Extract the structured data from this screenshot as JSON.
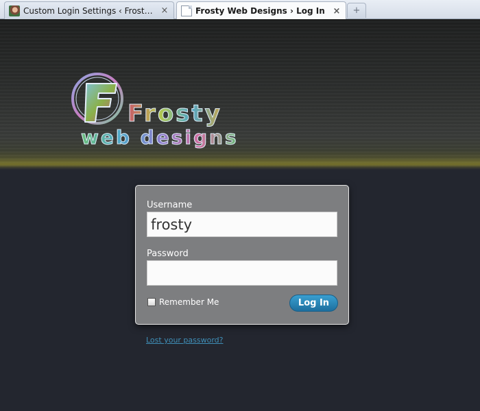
{
  "browser": {
    "tabs": [
      {
        "title": "Custom Login Settings ‹ Frosty Web...",
        "close": "×"
      },
      {
        "title": "Frosty Web Designs › Log In",
        "close": "×"
      }
    ],
    "new_tab": "+"
  },
  "header": {
    "logo_line1": "Frosty",
    "logo_line2": "web designs"
  },
  "login": {
    "username_label": "Username",
    "username_value": "frosty",
    "password_label": "Password",
    "password_value": "",
    "remember_label": "Remember Me",
    "remember_checked": false,
    "submit_label": "Log In"
  },
  "lost_password": "Lost your password?",
  "colors": {
    "background": "#23262f",
    "login_box": "#7d7e80",
    "button": "#2185b8",
    "link": "#3f8fb8"
  }
}
